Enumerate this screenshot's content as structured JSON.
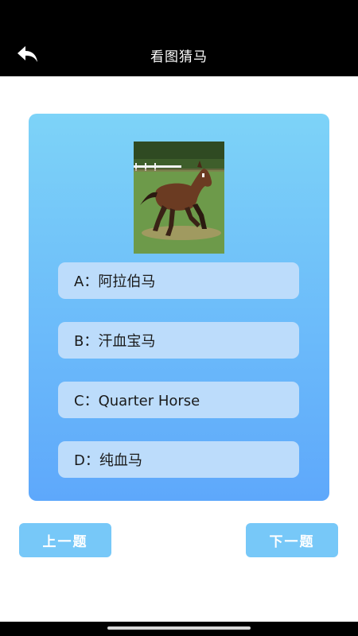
{
  "header": {
    "title": "看图猜马",
    "back_icon": "back-arrow-icon"
  },
  "quiz": {
    "options": [
      {
        "label": "A：阿拉伯马"
      },
      {
        "label": "B：汗血宝马"
      },
      {
        "label": "C：Quarter Horse"
      },
      {
        "label": "D：纯血马"
      }
    ]
  },
  "footer": {
    "prev_label": "上一题",
    "next_label": "下一题"
  },
  "colors": {
    "header_bg": "#000000",
    "card_gradient_top": "#7dd3f8",
    "card_gradient_bottom": "#5ea8fb",
    "option_bg": "#bcdcfb",
    "nav_button_bg": "#77c8f8"
  }
}
